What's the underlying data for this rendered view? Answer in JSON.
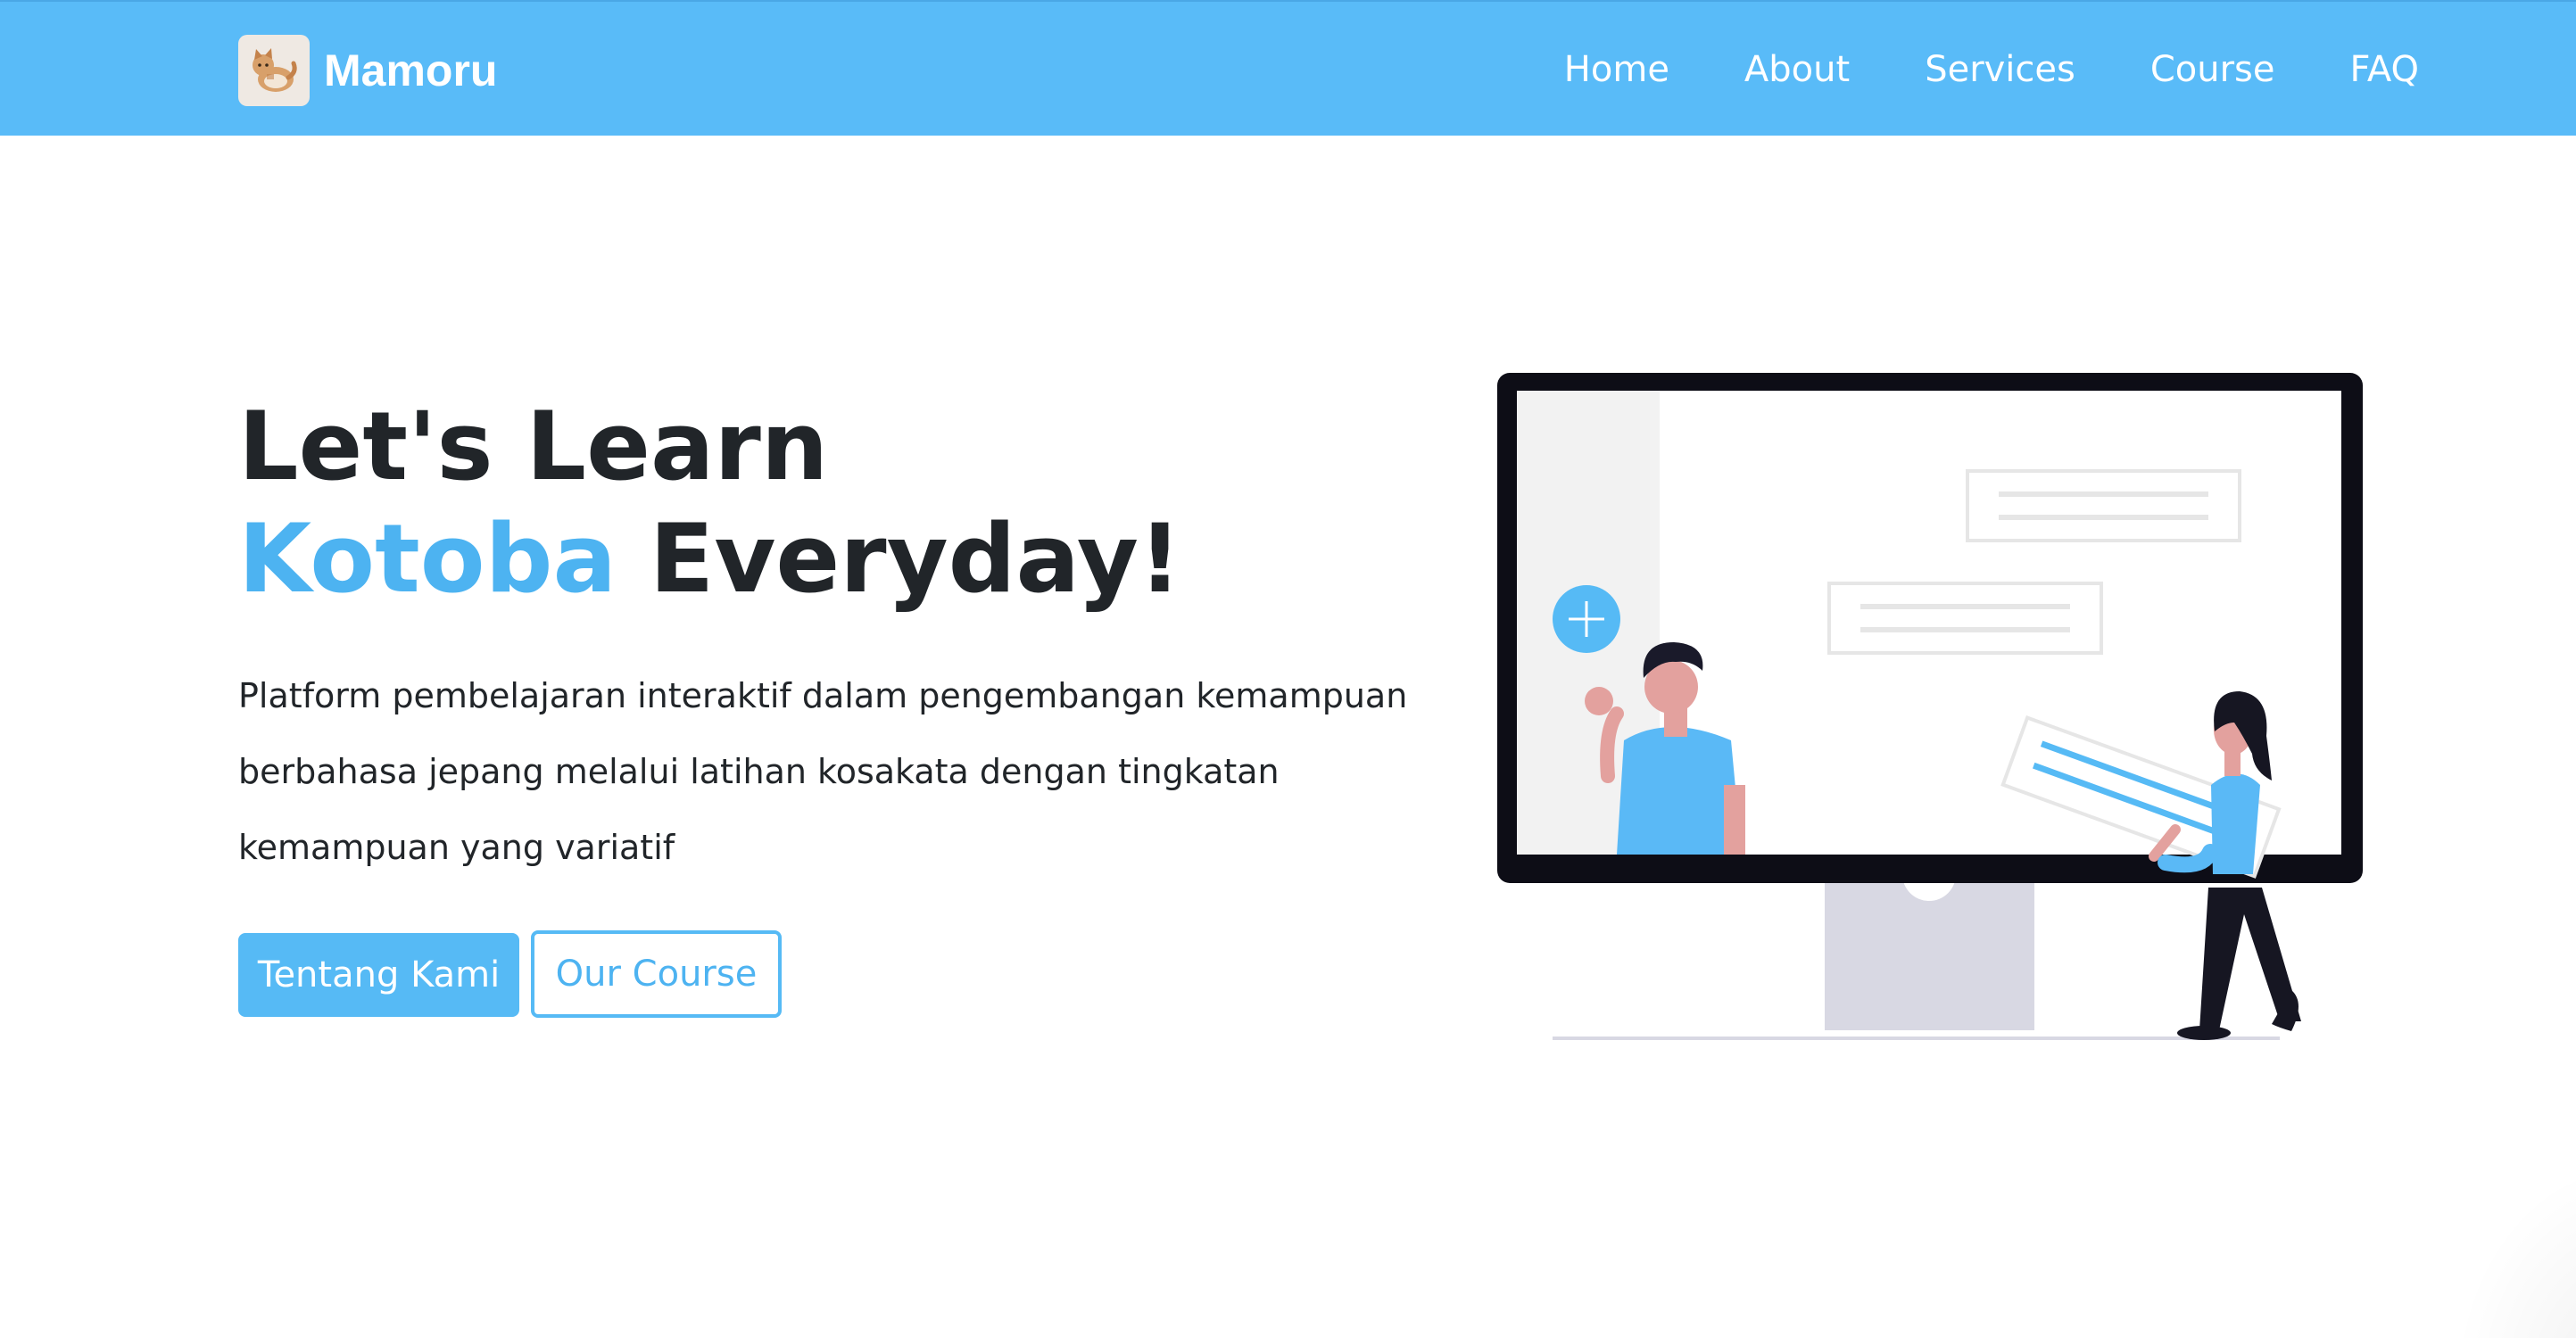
{
  "navbar": {
    "brand": "Mamoru",
    "links": [
      "Home",
      "About",
      "Services",
      "Course",
      "FAQ"
    ]
  },
  "hero": {
    "title_line1": "Let's Learn",
    "title_accent": "Kotoba",
    "title_rest": "Everyday!",
    "description": "Platform pembelajaran interaktif dalam pengembangan kemampuan berbahasa jepang melalui latihan kosakata dengan tingkatan kemampuan yang variatif",
    "primary_button": "Tentang Kami",
    "secondary_button": "Our Course"
  },
  "colors": {
    "navbar": "#59bbf8",
    "accent": "#4db3f1",
    "text": "#212529"
  }
}
